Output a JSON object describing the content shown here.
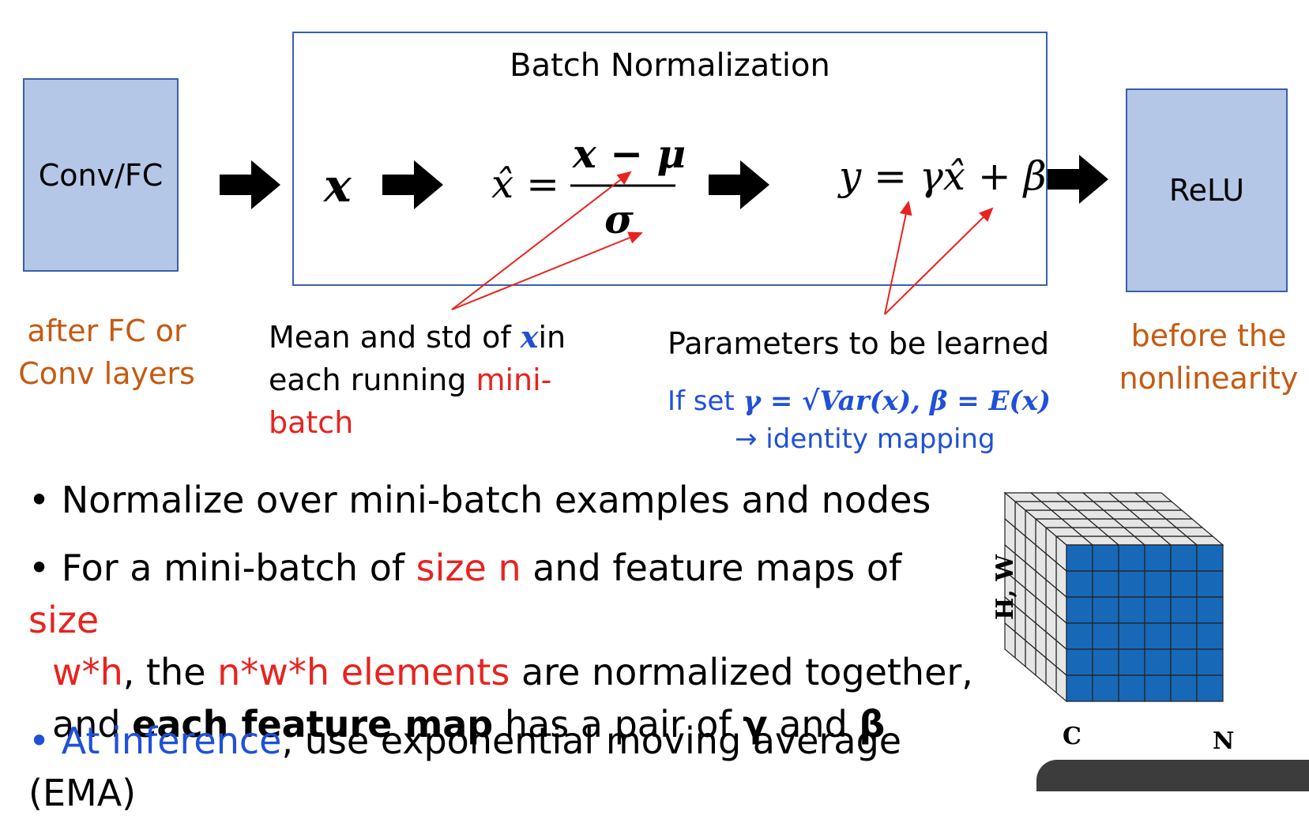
{
  "diagram": {
    "left_box": "Conv/FC",
    "right_box": "ReLU",
    "bn_title": "Batch Normalization",
    "bn_input": "x",
    "formula_lhs": "x̂ =",
    "formula_num": "x − μ",
    "formula_den": "σ",
    "formula_out": "y = γx̂ + β",
    "left_note_line1": "after FC or",
    "left_note_line2": "Conv layers",
    "right_note_line1": "before the",
    "right_note_line2": "nonlinearity",
    "mean_note": {
      "part1": "Mean and std of ",
      "x": "x",
      "part2": "in",
      "part3": "each running ",
      "part4": "mini-batch"
    },
    "params_note": "Parameters to be learned",
    "identity_note": {
      "prefix": "If set ",
      "formula": "γ = √Var(x), β = E(x)",
      "line2": "→ identity mapping"
    }
  },
  "bullets": [
    {
      "text": "Normalize over mini-batch examples and nodes"
    },
    {
      "a": "For a mini-batch of ",
      "b": "size n",
      "c": " and feature maps of ",
      "d": "size",
      "e": "w*h",
      "f": ", the ",
      "g": "n*w*h elements",
      "h": " are normalized together,",
      "i": "and ",
      "j": "each feature map",
      "k": " has a pair of ",
      "l": "γ",
      "m": " and ",
      "n": "β"
    },
    {
      "a": "At inference",
      "b": ", use exponential moving average (EMA)"
    }
  ],
  "cube": {
    "label_hw": "H, W",
    "label_c": "C",
    "label_n": "N",
    "highlight_color": "#1868b8",
    "face_color": "#e6e6e6"
  },
  "colors": {
    "box_fill": "#b4c7e7",
    "box_border": "#3a5faa",
    "orange": "#c55a11",
    "red": "#e8231f",
    "blue": "#1f50d8"
  }
}
